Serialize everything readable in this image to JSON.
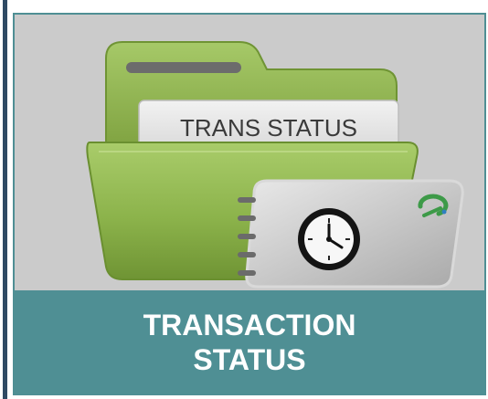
{
  "tile": {
    "folder_tab_label": "TRANS STATUS",
    "title_line1": "TRANSACTION",
    "title_line2": "STATUS",
    "icons": [
      "folder-icon",
      "payment-card-icon",
      "clock-icon",
      "logo-icon"
    ]
  },
  "colors": {
    "tile_background": "#cbcbcb",
    "caption_background": "#4f8f94",
    "caption_text": "#ffffff",
    "folder_green": "#8fb64f",
    "left_rule": "#2f4a63"
  }
}
